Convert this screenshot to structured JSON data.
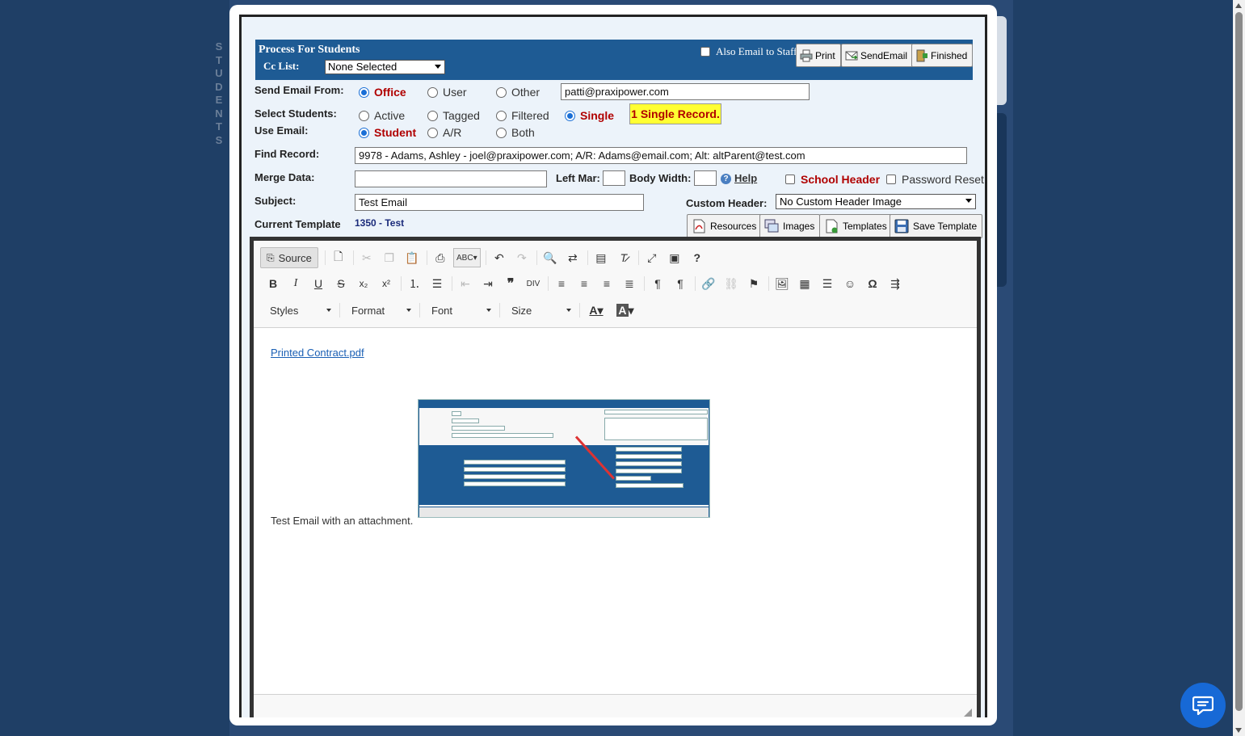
{
  "background": {
    "vertical_label": "STUDENTS"
  },
  "header": {
    "title": "Process For Students",
    "cc_label": "Cc List:",
    "cc_value": "None Selected",
    "also_email_staff": "Also Email to Staff",
    "buttons": {
      "print": "Print",
      "send_email": "SendEmail",
      "finished": "Finished"
    }
  },
  "send_from": {
    "label": "Send Email From:",
    "options": [
      "Office",
      "User",
      "Other"
    ],
    "selected": "Office",
    "email_value": "patti@praxipower.com"
  },
  "select_students": {
    "label": "Select Students:",
    "options": [
      "Active",
      "Tagged",
      "Filtered",
      "Single"
    ],
    "selected": "Single",
    "badge": "1 Single Record."
  },
  "use_email": {
    "label": "Use Email:",
    "options": [
      "Student",
      "A/R",
      "Both"
    ],
    "selected": "Student"
  },
  "find_record": {
    "label": "Find Record:",
    "value": "9978 - Adams, Ashley - joel@praxipower.com; A/R: Adams@email.com; Alt: altParent@test.com"
  },
  "merge_data": {
    "label": "Merge Data:",
    "value": "",
    "left_mar_label": "Left Mar:",
    "body_width_label": "Body Width:",
    "help_label": "Help",
    "school_header_label": "School Header",
    "password_reset_label": "Password Reset"
  },
  "subject": {
    "label": "Subject:",
    "value": "Test Email"
  },
  "custom_header": {
    "label": "Custom Header:",
    "value": "No Custom Header Image"
  },
  "current_template": {
    "label": "Current Template",
    "value": "1350 - Test"
  },
  "action_buttons": {
    "resources": "Resources",
    "images": "Images",
    "templates": "Templates",
    "save_template": "Save Template"
  },
  "editor": {
    "source_label": "Source",
    "styles_label": "Styles",
    "format_label": "Format",
    "font_label": "Font",
    "size_label": "Size",
    "attachment_link": "Printed Contract.pdf",
    "body_text": "Test Email with an attachment."
  },
  "colors": {
    "header_bar": "#1e5b94",
    "accent_red": "#b00000",
    "badge_yellow": "#ffff33",
    "radio_blue": "#1a6fd6"
  }
}
